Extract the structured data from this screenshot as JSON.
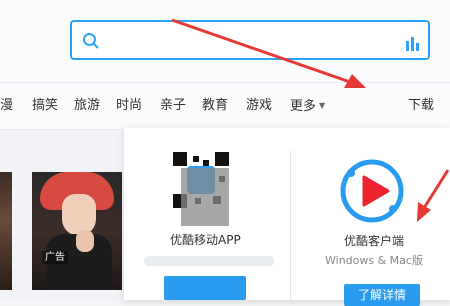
{
  "nav": {
    "items": [
      "漫",
      "搞笑",
      "旅游",
      "时尚",
      "亲子",
      "教育",
      "游戏"
    ],
    "more_label": "更多",
    "download_label": "下载"
  },
  "content": {
    "ad_tag": "广告"
  },
  "download_popup": {
    "app_label": "优酷移动APP",
    "client_label": "优酷客户端",
    "client_platforms": "Windows & Mac版",
    "details_button": "了解详情"
  },
  "colors": {
    "accent": "#2a9cf0",
    "annotation_arrow": "#e53935",
    "logo_red": "#ee2230"
  },
  "icons": {
    "search": "magnifier-icon",
    "voice": "bar-chart-icon",
    "client": "youku-play-logo-icon",
    "more": "caret-down-icon"
  }
}
